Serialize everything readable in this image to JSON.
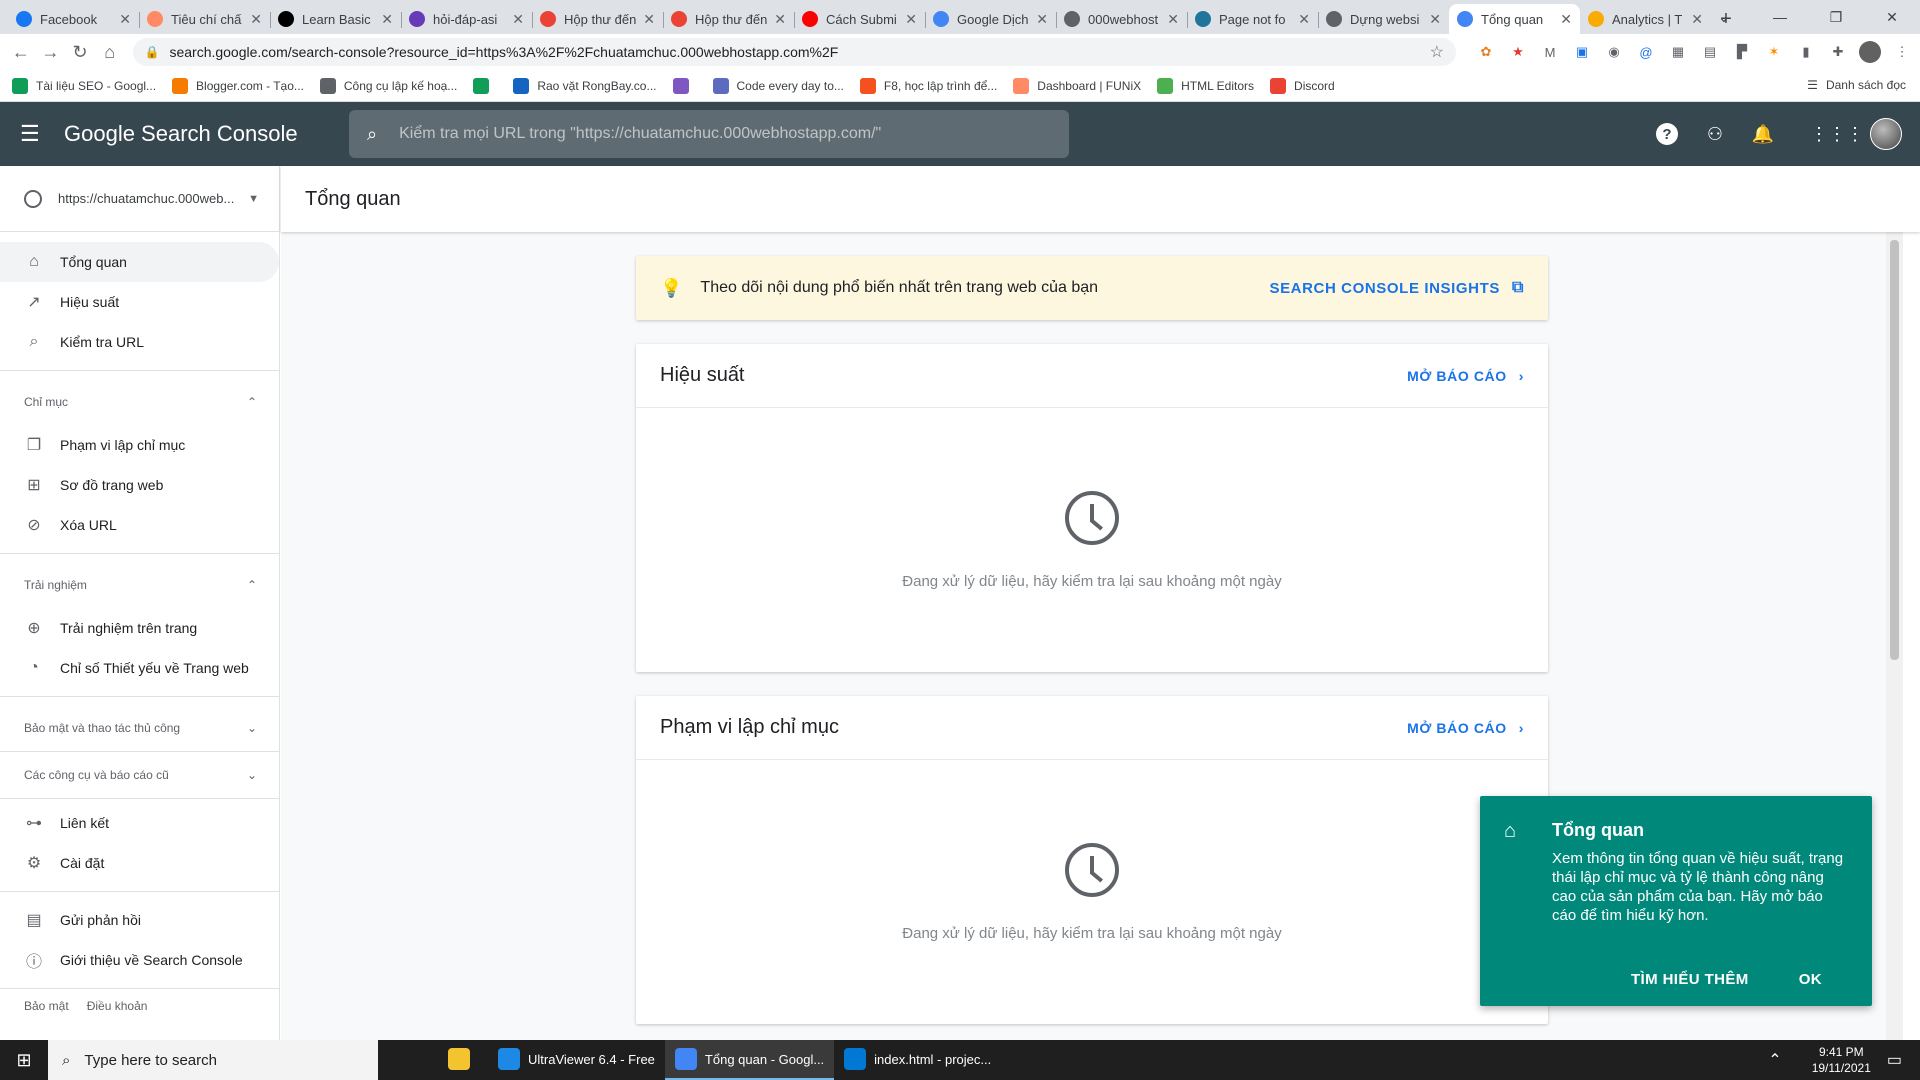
{
  "browser": {
    "tabs": [
      {
        "title": "Facebook",
        "color": "#1877f2"
      },
      {
        "title": "Tiêu chí chấ",
        "color": "#ff8a65"
      },
      {
        "title": "Learn Basic",
        "color": "#000000"
      },
      {
        "title": "hỏi-đáp-asi",
        "color": "#673ab7"
      },
      {
        "title": "Hộp thư đến",
        "color": "#ea4335"
      },
      {
        "title": "Hộp thư đến",
        "color": "#ea4335"
      },
      {
        "title": "Cách Submi",
        "color": "#ff0000"
      },
      {
        "title": "Google Dịch",
        "color": "#4285f4"
      },
      {
        "title": "000webhost",
        "color": "#5f6368"
      },
      {
        "title": "Page not fo",
        "color": "#21759b"
      },
      {
        "title": "Dựng websi",
        "color": "#5f6368"
      },
      {
        "title": "Tổng quan",
        "color": "#4285f4",
        "active": true
      },
      {
        "title": "Analytics | T",
        "color": "#f9ab00"
      }
    ],
    "url": "search.google.com/search-console?resource_id=https%3A%2F%2Fchuatamchuc.000webhostapp.com%2F",
    "bookmarks": [
      {
        "label": "Tài liệu SEO - Googl...",
        "color": "#0f9d58"
      },
      {
        "label": "Blogger.com - Tạo...",
        "color": "#f57c00"
      },
      {
        "label": "Công cụ lập kế hoạ...",
        "color": "#5f6368"
      },
      {
        "label": "",
        "color": "#0f9d58"
      },
      {
        "label": "Rao vặt RongBay.co...",
        "color": "#1565c0"
      },
      {
        "label": "",
        "color": "#7e57c2"
      },
      {
        "label": "Code every day to...",
        "color": "#5c6bc0"
      },
      {
        "label": "F8, học lập trình để...",
        "color": "#f4511e"
      },
      {
        "label": "Dashboard | FUNiX",
        "color": "#ff8a65"
      },
      {
        "label": "HTML Editors",
        "color": "#4caf50"
      },
      {
        "label": "Discord",
        "color": "#ea4335"
      }
    ],
    "reading_list": "Danh sách đọc"
  },
  "app": {
    "brand": "Google Search Console",
    "search_placeholder": "Kiểm tra mọi URL trong \"https://chuatamchuc.000webhostapp.com/\"",
    "property": "https://chuatamchuc.000web...",
    "page_title": "Tổng quan"
  },
  "sidebar": {
    "top": [
      {
        "label": "Tổng quan",
        "icon": "⌂"
      },
      {
        "label": "Hiệu suất",
        "icon": "↗"
      },
      {
        "label": "Kiểm tra URL",
        "icon": "⌕"
      }
    ],
    "index_section": "Chỉ mục",
    "index_items": [
      {
        "label": "Phạm vi lập chỉ mục",
        "icon": "❐"
      },
      {
        "label": "Sơ đồ trang web",
        "icon": "⊞"
      },
      {
        "label": "Xóa URL",
        "icon": "⊘"
      }
    ],
    "experience_section": "Trải nghiệm",
    "experience_items": [
      {
        "label": "Trải nghiệm trên trang",
        "icon": "⊕"
      },
      {
        "label": "Chỉ số Thiết yếu về Trang web",
        "icon": "◔"
      }
    ],
    "security_section": "Bảo mật và thao tác thủ công",
    "legacy_section": "Các công cụ và báo cáo cũ",
    "bottom_items": [
      {
        "label": "Liên kết",
        "icon": "⊶"
      },
      {
        "label": "Cài đặt",
        "icon": "⚙"
      }
    ],
    "help_items": [
      {
        "label": "Gửi phản hồi",
        "icon": "▤"
      },
      {
        "label": "Giới thiệu về Search Console",
        "icon": "ⓘ"
      }
    ],
    "footer": [
      "Bảo mật",
      "Điều khoản"
    ]
  },
  "insights": {
    "text": "Theo dõi nội dung phổ biến nhất trên trang web của bạn",
    "link": "SEARCH CONSOLE INSIGHTS"
  },
  "cards": [
    {
      "title": "Hiệu suất",
      "link": "MỞ BÁO CÁO",
      "message": "Đang xử lý dữ liệu, hãy kiểm tra lại sau khoảng một ngày"
    },
    {
      "title": "Phạm vi lập chỉ mục",
      "link": "MỞ BÁO CÁO",
      "message": "Đang xử lý dữ liệu, hãy kiểm tra lại sau khoảng một ngày"
    }
  ],
  "tooltip": {
    "title": "Tổng quan",
    "body": "Xem thông tin tổng quan về hiệu suất, trạng thái lập chỉ mục và tỷ lệ thành công nâng cao của sản phẩm của bạn. Hãy mở báo cáo để tìm hiểu kỹ hơn.",
    "learn_more": "TÌM HIỂU THÊM",
    "ok": "OK"
  },
  "taskbar": {
    "search_placeholder": "Type here to search",
    "apps": [
      {
        "label": "",
        "color": "#f4c430"
      },
      {
        "label": "UltraViewer 6.4 - Free",
        "color": "#1e88e5"
      },
      {
        "label": "Tổng quan - Googl...",
        "color": "#4285f4",
        "active": true
      },
      {
        "label": "index.html - projec...",
        "color": "#0078d4"
      }
    ],
    "time": "9:41 PM",
    "date": "19/11/2021"
  }
}
